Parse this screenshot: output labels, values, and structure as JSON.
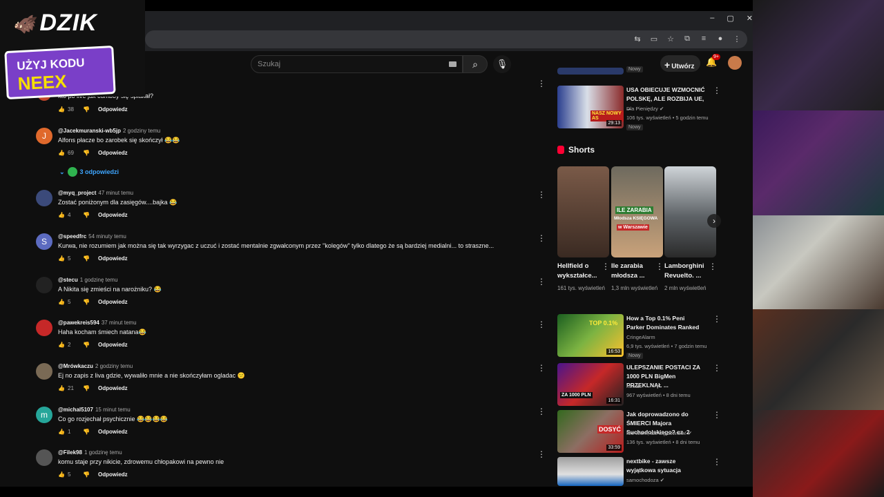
{
  "window": {
    "controls": [
      "–",
      "▢",
      "✕"
    ]
  },
  "brand": {
    "logo_text": "DZIK",
    "promo_line1": "UŻYJ KODU",
    "promo_line2": "NEEX"
  },
  "header": {
    "search_placeholder": "Szukaj",
    "create_label": "Utwórz",
    "notif_badge": "9+"
  },
  "colors": {
    "link": "#3ea6ff",
    "accent": "#ff0033",
    "bg": "#0f0f0f"
  },
  "comments": [
    {
      "user": "",
      "time": "",
      "text": "kto po live jak cumboy się spłakał?",
      "likes": "38",
      "reply": "Odpowiedz"
    },
    {
      "user": "@Jacekmuranski-wb5jp",
      "time": "2 godziny temu",
      "text": "Alfons płacze bo zarobek się skończył 😂😂",
      "likes": "69",
      "reply": "Odpowiedz",
      "avatar_letter": "J"
    },
    {
      "user": "@myq_project",
      "time": "47 minut temu",
      "text": "Zostać poniżonym dla zasięgów....bajka 😂",
      "likes": "4",
      "reply": "Odpowiedz"
    },
    {
      "user": "@speedfrc",
      "time": "54 minuty temu",
      "text": "Kurwa, nie rozumiem jak można się tak wyrzygac z uczuć i zostać mentalnie zgwałconym przez \"kolegów\" tylko dlatego że są bardziej medialni... to straszne...",
      "likes": "5",
      "reply": "Odpowiedz",
      "avatar_letter": "S"
    },
    {
      "user": "@stecu",
      "time": "1 godzinę temu",
      "text": "A Nikita się zmieści na narożniku? 😂",
      "likes": "5",
      "reply": "Odpowiedz"
    },
    {
      "user": "@pawekreis594",
      "time": "37 minut temu",
      "text": "Haha kocham śmiech natana😂",
      "likes": "2",
      "reply": "Odpowiedz"
    },
    {
      "user": "@Mrówkaczu",
      "time": "2 godziny temu",
      "text": "Ej no zapis z liva gdzie, wywaliło mnie a nie skończyłam ogladac 😕",
      "likes": "21",
      "reply": "Odpowiedz"
    },
    {
      "user": "@michal5107",
      "time": "15 minut temu",
      "text": "Co go rozjechał psychicznie 😂😂😂😂",
      "likes": "1",
      "reply": "Odpowiedz",
      "avatar_letter": "m"
    },
    {
      "user": "@Filek98",
      "time": "1 godzinę temu",
      "text": "komu staje przy nikicie, zdrowemu chłopakowi na pewno nie",
      "likes": "5",
      "reply": "Odpowiedz"
    }
  ],
  "replies_toggle": "3 odpowiedzi",
  "sidebar": {
    "top_video": {
      "title": "USA OBIECUJE WZMOCNIĆ POLSKĘ, ALE ROZBIJA UE, ...",
      "channel": "Dla Pieniędzy",
      "views": "106 tys. wyświetleń • 5 godzin temu",
      "badge": "Nowy",
      "duration": "29:13",
      "thumb_text": "NASZ NOWY AS"
    },
    "prev_badge": "Nowy",
    "shorts_title": "Shorts",
    "shorts": [
      {
        "title": "Hellfield o wykształce...",
        "views": "161 tys. wyświetleń"
      },
      {
        "title": "Ile zarabia młodsza ...",
        "views": "1,3 mln wyświetleń",
        "thumb_l1": "ILE ZARABIA",
        "thumb_l2": "Młodsza KSIĘGOWA",
        "thumb_l3": "w Warszawie"
      },
      {
        "title": "Lamborghini Revuelto. ...",
        "views": "2 mln wyświetleń"
      }
    ],
    "videos": [
      {
        "title": "How a Top 0.1% Peni Parker Dominates Ranked",
        "channel": "CringeAlarm",
        "views": "6,9 tys. wyświetleń • 7 godzin temu",
        "badge": "Nowy",
        "duration": "16:53",
        "thumb_text": "TOP 0.1%"
      },
      {
        "title": "ULEPSZANIE POSTACI ZA 1000 PLN BigMen PRZEKLNĄŁ ...",
        "channel": "nowak",
        "views": "967 wyświetleń • 8 dni temu",
        "duration": "16:31",
        "thumb_text": "ZA 1000 PLN"
      },
      {
        "title": "Jak doprowadzono do ŚMIERCI Majora Suchodolskiego? cz. 2",
        "channel": "Nie wiem, ale się dowiem!",
        "views": "136 tys. wyświetleń • 8 dni temu",
        "duration": "33:59",
        "thumb_text": "DOSYĆ"
      },
      {
        "title": "nextbike - zawsze wyjątkowa sytuacja",
        "channel": "samochodoza",
        "views": ""
      }
    ]
  }
}
